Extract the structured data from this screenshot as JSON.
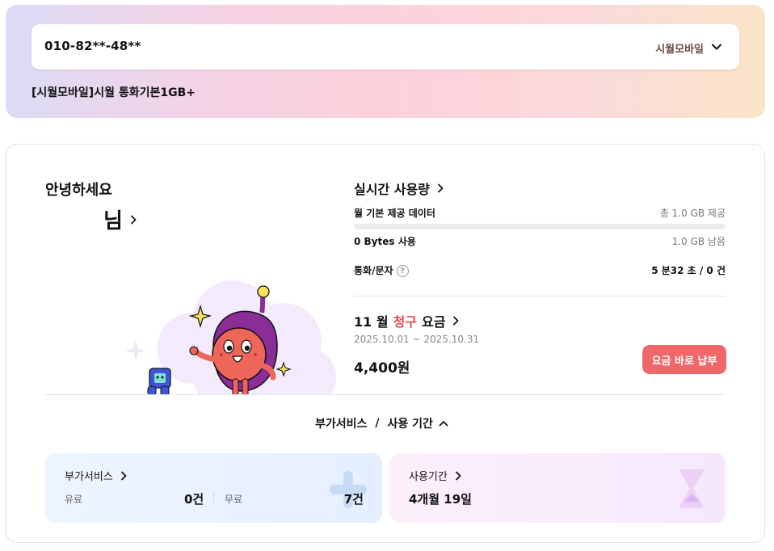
{
  "line": {
    "phone": "010-82**-48**",
    "carrier": "시월모바일",
    "plan": "[시월모바일]시월 통화기본1GB+"
  },
  "greeting": {
    "hello": "안녕하세요",
    "name": "님"
  },
  "usage": {
    "title": "실시간 사용량",
    "data_label": "월 기본 제공 데이터",
    "data_total": "총 1.0 GB 제공",
    "data_used": "0 Bytes 사용",
    "data_remaining": "1.0 GB 남음",
    "data_used_fraction": 0,
    "call_label": "통화/문자",
    "call_help": "?",
    "call_value": "5 분32 초 / 0 건"
  },
  "bill": {
    "month": "11 월",
    "claim": "청구",
    "fee": "요금",
    "period": "2025.10.01 ~ 2025.10.31",
    "amount": "4,400원",
    "pay_button": "요금 바로 납부"
  },
  "toggle": {
    "addon": "부가서비스",
    "sep": "/",
    "period": "사용 기간"
  },
  "addon_tile": {
    "title": "부가서비스",
    "paid_label": "유료",
    "paid_value": "0건",
    "free_label": "무료",
    "free_value": "7건"
  },
  "period_tile": {
    "title": "사용기간",
    "value": "4개월 19일"
  },
  "colors": {
    "accent_red": "#f0676a",
    "claim_red": "#e74c4c"
  },
  "icons": {
    "dropdown": "chevron-down-icon",
    "link": "chevron-right-icon",
    "collapse": "chevron-up-icon",
    "help": "question-circle-icon",
    "addon_deco": "plus-icon",
    "period_deco": "hourglass-icon"
  }
}
